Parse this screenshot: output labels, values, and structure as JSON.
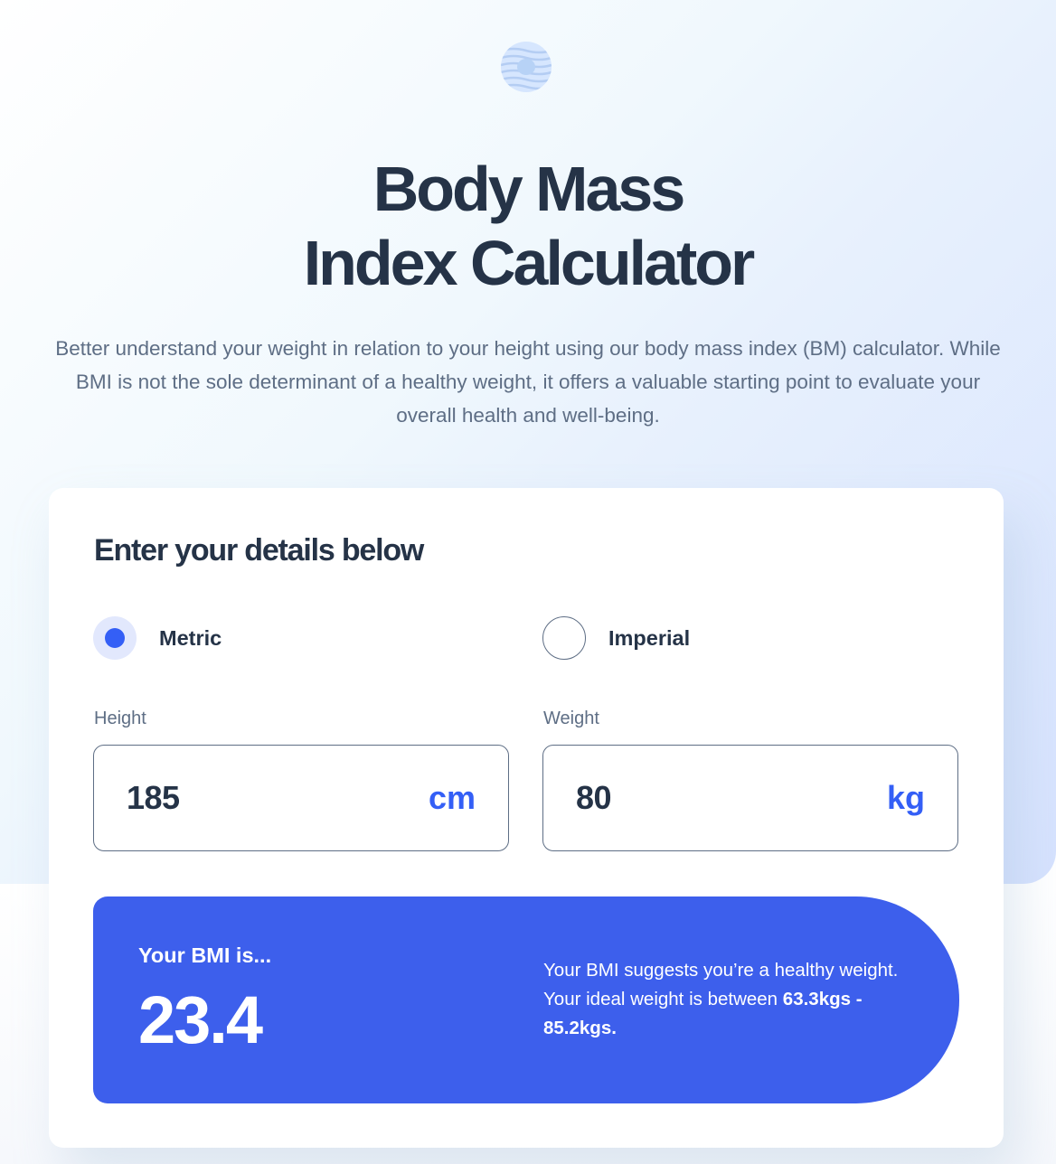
{
  "header": {
    "logo_icon": "striped-circle-logo-icon",
    "title_line1": "Body Mass",
    "title_line2": "Index Calculator",
    "description": "Better understand your weight in relation to your height using our body mass index (BM) calculator. While BMI is not the sole determinant of a healthy weight, it offers a valuable starting point to evaluate your overall health and well-being."
  },
  "form": {
    "title": "Enter your details below",
    "unit_options": [
      {
        "label": "Metric",
        "checked": true
      },
      {
        "label": "Imperial",
        "checked": false
      }
    ],
    "height": {
      "label": "Height",
      "value": "185",
      "unit": "cm"
    },
    "weight": {
      "label": "Weight",
      "value": "80",
      "unit": "kg"
    }
  },
  "result": {
    "label": "Your BMI is...",
    "value": "23.4",
    "description": "Your BMI suggests you’re a healthy weight. Your ideal weight is between",
    "range": "63.3kgs - 85.2kgs."
  },
  "colors": {
    "primary_blue": "#345ff6",
    "result_bg": "#3d5fec",
    "gunmetal": "#253347",
    "dark_electric_blue": "#5e6e85"
  }
}
